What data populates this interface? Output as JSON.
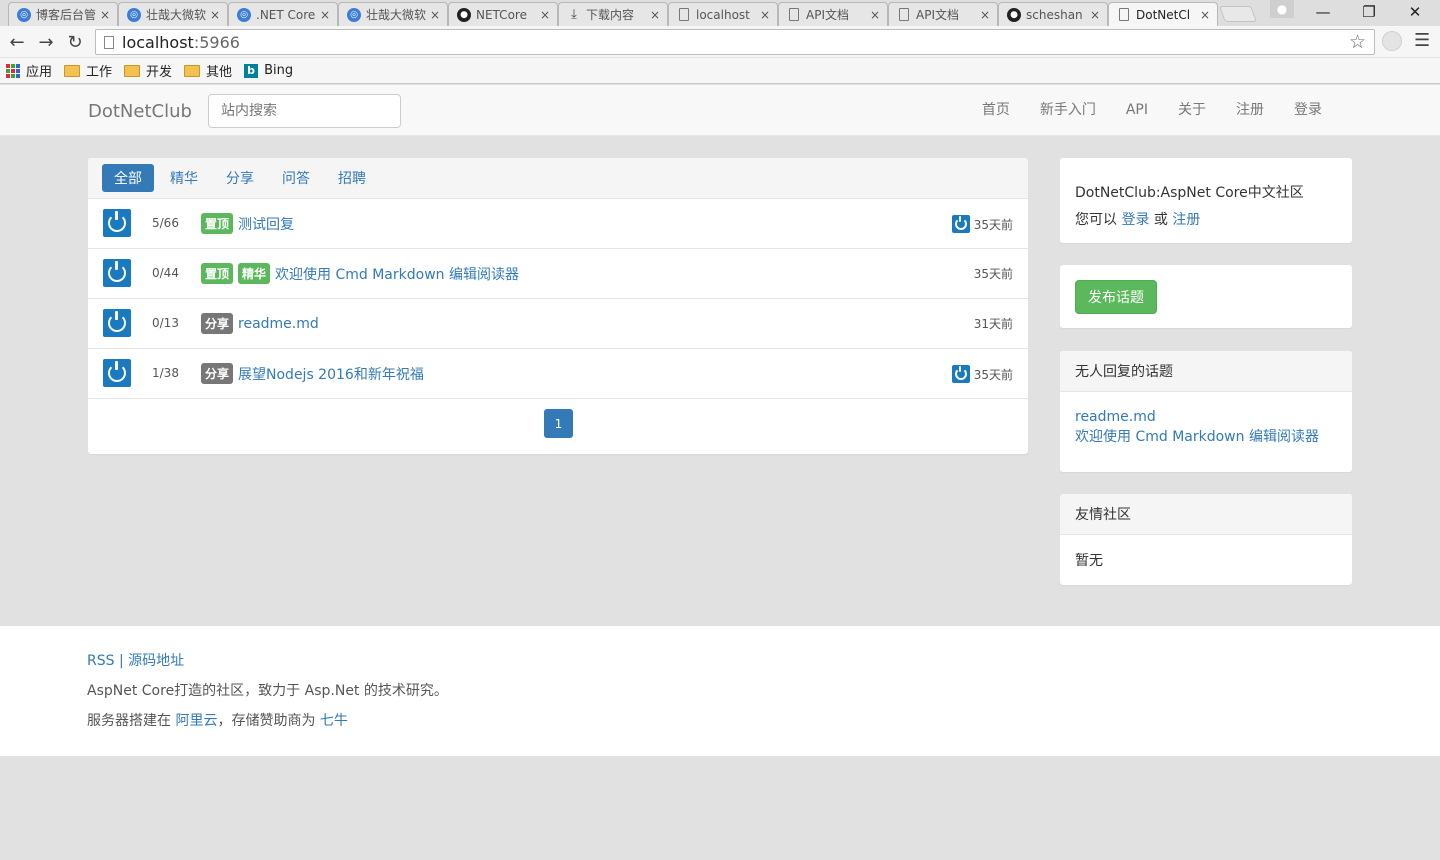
{
  "browser": {
    "tabs": [
      {
        "title": "博客后台管",
        "icon": "web"
      },
      {
        "title": "壮哉大微软",
        "icon": "web"
      },
      {
        "title": ".NET Core",
        "icon": "web"
      },
      {
        "title": "壮哉大微软",
        "icon": "web"
      },
      {
        "title": "NETCore",
        "icon": "github"
      },
      {
        "title": "下载内容",
        "icon": "download"
      },
      {
        "title": "localhost",
        "icon": "doc"
      },
      {
        "title": "API文档",
        "icon": "doc"
      },
      {
        "title": "API文档",
        "icon": "doc"
      },
      {
        "title": "scheshan",
        "icon": "github"
      },
      {
        "title": "DotNetCl",
        "icon": "doc"
      }
    ],
    "close_glyph": "×",
    "address_host": "localhost",
    "address_port": ":5966",
    "bookmarks": [
      {
        "label": "应用",
        "icon": "apps"
      },
      {
        "label": "工作",
        "icon": "folder"
      },
      {
        "label": "开发",
        "icon": "folder"
      },
      {
        "label": "其他",
        "icon": "folder"
      },
      {
        "label": "Bing",
        "icon": "bing"
      }
    ]
  },
  "navbar": {
    "brand": "DotNetClub",
    "search_placeholder": "站内搜索",
    "links": [
      "首页",
      "新手入门",
      "API",
      "关于",
      "注册",
      "登录"
    ]
  },
  "topics": {
    "tabs": [
      "全部",
      "精华",
      "分享",
      "问答",
      "招聘"
    ],
    "active_tab": "全部",
    "rows": [
      {
        "count": "5/66",
        "badges": [
          {
            "text": "置顶",
            "color": "green"
          }
        ],
        "title": "测试回复",
        "time": "35天前",
        "last_reply_avatar": true
      },
      {
        "count": "0/44",
        "badges": [
          {
            "text": "置顶",
            "color": "green"
          },
          {
            "text": "精华",
            "color": "green"
          }
        ],
        "title": "欢迎使用 Cmd Markdown 编辑阅读器",
        "time": "35天前",
        "last_reply_avatar": false
      },
      {
        "count": "0/13",
        "badges": [
          {
            "text": "分享",
            "color": "gray"
          }
        ],
        "title": "readme.md",
        "time": "31天前",
        "last_reply_avatar": false
      },
      {
        "count": "1/38",
        "badges": [
          {
            "text": "分享",
            "color": "gray"
          }
        ],
        "title": "展望Nodejs 2016和新年祝福",
        "time": "35天前",
        "last_reply_avatar": true
      }
    ],
    "pagination": [
      "1"
    ]
  },
  "sidebar": {
    "intro": {
      "line1": "DotNetClub:AspNet Core中文社区",
      "prefix": "您可以",
      "login": "登录",
      "or": "或",
      "register": "注册"
    },
    "publish_button": "发布话题",
    "no_reply": {
      "title": "无人回复的话题",
      "items": [
        "readme.md",
        "欢迎使用 Cmd Markdown 编辑阅读器"
      ]
    },
    "friends": {
      "title": "友情社区",
      "body": "暂无"
    }
  },
  "footer": {
    "rss": "RSS",
    "sep": " | ",
    "source": "源码地址",
    "line2": "AspNet Core打造的社区，致力于 Asp.Net 的技术研究。",
    "line3_prefix": "服务器搭建在 ",
    "aliyun": "阿里云",
    "line3_mid": "，存储赞助商为 ",
    "qiniu": "七牛"
  },
  "colors": {
    "primary": "#337ab7",
    "success": "#5cb85c",
    "badge_gray": "#777777",
    "avatar": "#1a7abf"
  }
}
